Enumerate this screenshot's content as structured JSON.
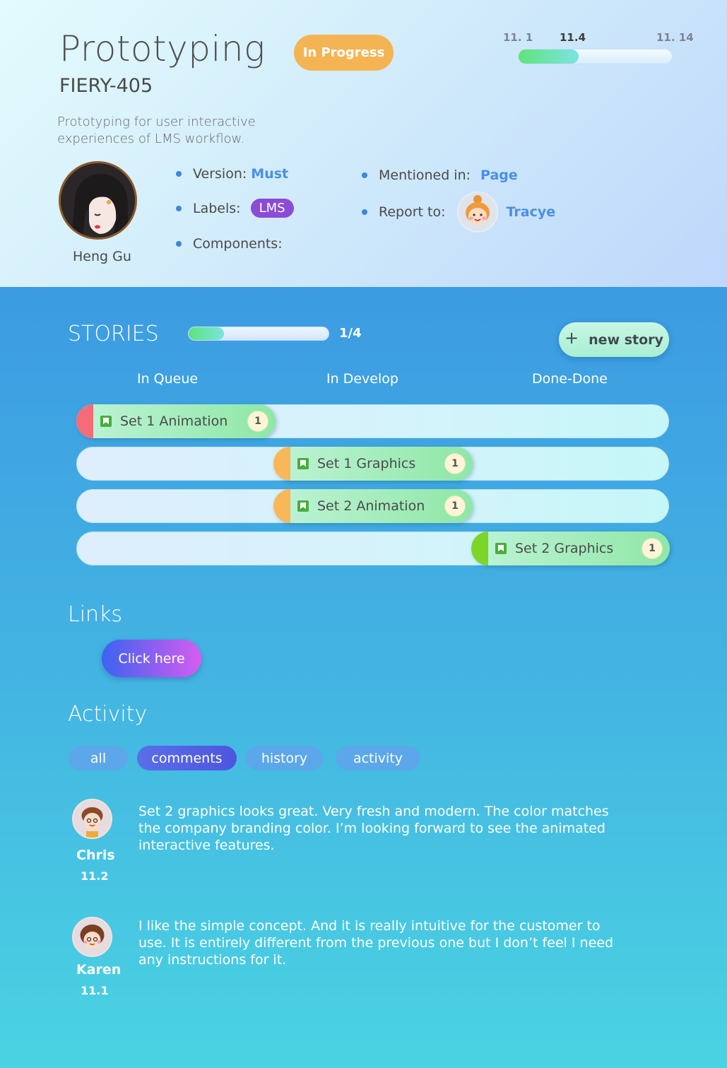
{
  "issue": {
    "title": "Prototyping",
    "key": "FIERY-405",
    "status": "In Progress",
    "description": "Prototyping for user interactive experiences of LMS workflow.",
    "owner": "Heng Gu"
  },
  "timeline": {
    "start": "11. 1",
    "current": "11.4",
    "end": "11. 14",
    "progress_fraction": 0.39
  },
  "meta": {
    "version_label": "Version:",
    "version_value": "Must",
    "labels_label": "Labels:",
    "labels_value": "LMS",
    "components_label": "Components:",
    "mentioned_label": "Mentioned in:",
    "mentioned_value": "Page",
    "report_label": "Report to:",
    "report_value": "Tracye"
  },
  "stories": {
    "title": "STORIES",
    "progress_text": "1/4",
    "progress_fraction": 0.25,
    "new_label": "new story",
    "columns": [
      "In Queue",
      "In Develop",
      "Done-Done"
    ],
    "items": [
      {
        "name": "Set 1 Animation",
        "count": "1",
        "column": "In Queue",
        "cap_color": "#f56b78"
      },
      {
        "name": "Set 1 Graphics",
        "count": "1",
        "column": "In Develop",
        "cap_color": "#f8b85a"
      },
      {
        "name": "Set 2 Animation",
        "count": "1",
        "column": "In Develop",
        "cap_color": "#f8b85a"
      },
      {
        "name": "Set 2 Graphics",
        "count": "1",
        "column": "Done-Done",
        "cap_color": "#7bd628"
      }
    ]
  },
  "links": {
    "title": "Links",
    "button": "Click here"
  },
  "activity": {
    "title": "Activity",
    "tabs": [
      "all",
      "comments",
      "history",
      "activity"
    ],
    "active_tab": "comments",
    "comments": [
      {
        "author": "Chris",
        "date": "11.2",
        "text": "Set 2 graphics looks great. Very fresh and modern. The color matches the company branding color. I’m looking forward to see the animated interactive features."
      },
      {
        "author": "Karen",
        "date": "11.1",
        "text": "I like the simple concept. And it is really intuitive for the customer to use. It is entirely different from the previous one but I don’t feel I need any instructions for it."
      }
    ]
  },
  "colors": {
    "status": "#f5b453",
    "link": "#4a90e2",
    "label_chip": "#8a4bd6",
    "bullet": "#3d86d8"
  }
}
